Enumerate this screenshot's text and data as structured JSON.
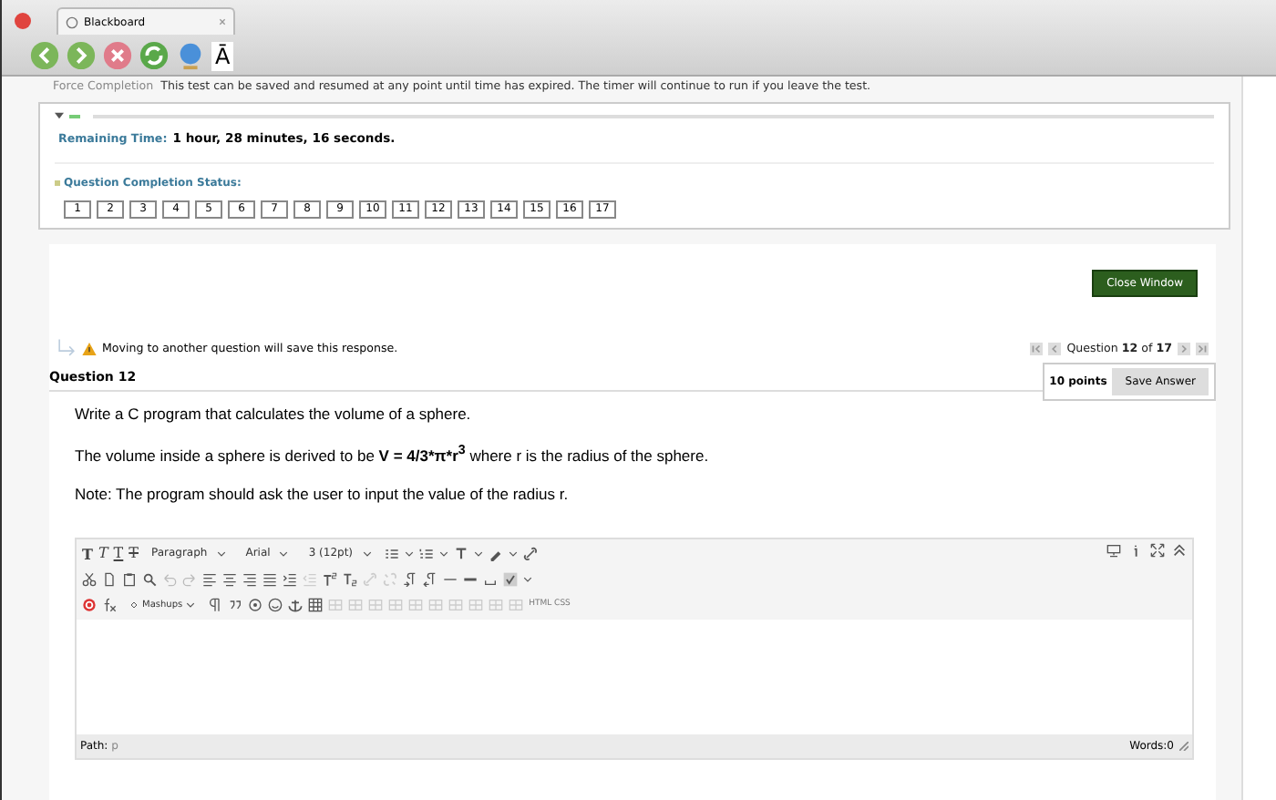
{
  "browser": {
    "tab_title": "Blackboard",
    "text_size_glyph": "Ā"
  },
  "test_info": {
    "label": "Force Completion",
    "text": "This test can be saved and resumed at any point until time has expired. The timer will continue to run if you leave the test."
  },
  "timer": {
    "label": "Remaining Time:",
    "value": "1 hour, 28 minutes, 16 seconds."
  },
  "completion": {
    "label": "Question Completion Status:",
    "questions": [
      "1",
      "2",
      "3",
      "4",
      "5",
      "6",
      "7",
      "8",
      "9",
      "10",
      "11",
      "12",
      "13",
      "14",
      "15",
      "16",
      "17"
    ]
  },
  "close_button": "Close Window",
  "warning": "Moving to another question will save this response.",
  "pager": "Question **12** of **17**",
  "question": {
    "title": "Question 12",
    "points": "10 points",
    "save_button": "Save Answer",
    "prompt": "Write a C program that calculates the volume of a sphere.",
    "formula": "The volume inside a sphere is derived to be **V = 4/3*π*r**$^{3}$ where r is the radius of the sphere.",
    "note": "Note: The program should ask the user to input the value of the radius r."
  },
  "editor": {
    "format_buttons": [
      "T",
      "T",
      "T",
      "T"
    ],
    "selects": [
      "Paragraph",
      "Arial",
      "3 (12pt)"
    ],
    "mashups": "Mashups",
    "html_css": "HTML CSS",
    "path_label": "Path:",
    "path": "p",
    "word_count": "Words:0"
  }
}
